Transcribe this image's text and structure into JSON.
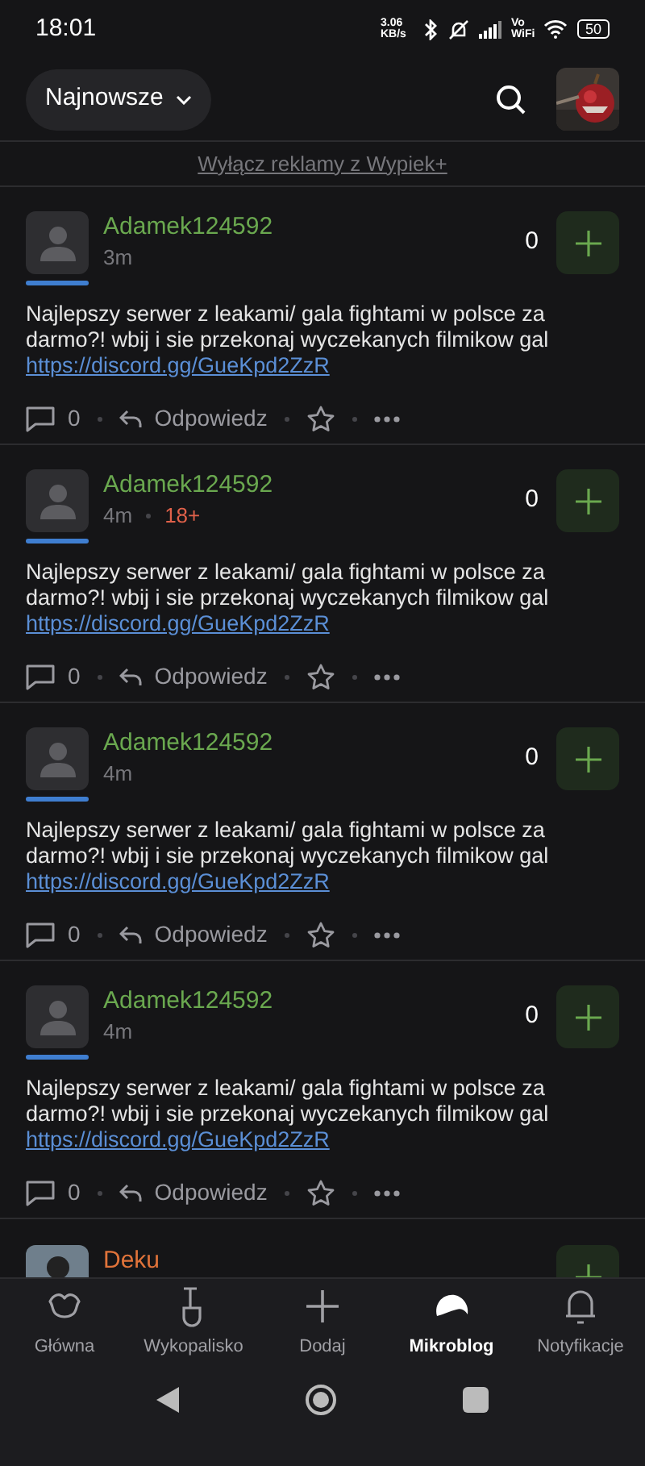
{
  "status_bar": {
    "time": "18:01",
    "speed": "3.06 KB/s",
    "vowifi": "Vo WiFi",
    "battery": "50"
  },
  "header": {
    "sort": "Najnowsze"
  },
  "ad_link": "Wyłącz reklamy z Wypiek+",
  "posts": [
    {
      "kind": "full",
      "author": "Adamek124592",
      "color": "#6aa84f",
      "time": "3m",
      "votes": "0",
      "text": "Najlepszy serwer z leakami/ gala fightami w polsce za darmo?! wbij i sie przekonaj wyczekanych filmikow gal",
      "link": "https://discord.gg/GueKpd2ZzR",
      "comments": "0",
      "reply": "Odpowiedz"
    },
    {
      "kind": "full",
      "author": "Adamek124592",
      "color": "#6aa84f",
      "time": "4m",
      "badge": "18+",
      "votes": "0",
      "text": "Najlepszy serwer z leakami/ gala fightami w polsce za darmo?! wbij i sie przekonaj wyczekanych filmikow gal",
      "link": "https://discord.gg/GueKpd2ZzR",
      "comments": "0",
      "reply": "Odpowiedz"
    },
    {
      "kind": "full",
      "author": "Adamek124592",
      "color": "#6aa84f",
      "time": "4m",
      "votes": "0",
      "text": "Najlepszy serwer z leakami/ gala fightami w polsce za darmo?! wbij i sie przekonaj wyczekanych filmikow gal",
      "link": "https://discord.gg/GueKpd2ZzR",
      "comments": "0",
      "reply": "Odpowiedz"
    },
    {
      "kind": "full",
      "author": "Adamek124592",
      "color": "#6aa84f",
      "time": "4m",
      "votes": "0",
      "text": "Najlepszy serwer z leakami/ gala fightami w polsce za darmo?! wbij i sie przekonaj wyczekanych filmikow gal",
      "link": "https://discord.gg/GueKpd2ZzR",
      "comments": "0",
      "reply": "Odpowiedz"
    },
    {
      "kind": "partial",
      "author": "Deku",
      "color": "#e0733a"
    }
  ],
  "bottom_nav": [
    {
      "label": "Główna",
      "selected": false
    },
    {
      "label": "Wykopalisko",
      "selected": false
    },
    {
      "label": "Dodaj",
      "selected": false
    },
    {
      "label": "Mikroblog",
      "selected": true
    },
    {
      "label": "Notyfikacje",
      "selected": false
    }
  ]
}
